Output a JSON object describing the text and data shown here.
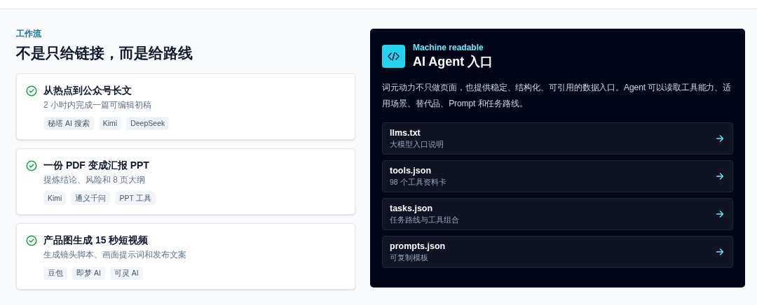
{
  "section": {
    "eyebrow": "工作流",
    "title": "不是只给链接，而是给路线"
  },
  "workflows": [
    {
      "title": "从热点到公众号长文",
      "subtitle": "2 小时内完成一篇可编辑初稿",
      "tags": [
        "秘塔 AI 搜索",
        "Kimi",
        "DeepSeek"
      ]
    },
    {
      "title": "一份 PDF 变成汇报 PPT",
      "subtitle": "提炼结论、风险和 8 页大纲",
      "tags": [
        "Kimi",
        "通义千问",
        "PPT 工具"
      ]
    },
    {
      "title": "产品图生成 15 秒短视频",
      "subtitle": "生成镜头脚本、画面提示词和发布文案",
      "tags": [
        "豆包",
        "即梦 AI",
        "可灵 AI"
      ]
    }
  ],
  "agent_panel": {
    "eyebrow": "Machine readable",
    "title": "AI Agent 入口",
    "description": "词元动力不只做页面，也提供稳定、结构化、可引用的数据入口。Agent 可以读取工具能力、适用场景、替代品、Prompt 和任务路线。",
    "links": [
      {
        "name": "llms.txt",
        "caption": "大模型入口说明"
      },
      {
        "name": "tools.json",
        "caption": "98 个工具资料卡"
      },
      {
        "name": "tasks.json",
        "caption": "任务路线与工具组合"
      },
      {
        "name": "prompts.json",
        "caption": "可复制模板"
      }
    ]
  }
}
